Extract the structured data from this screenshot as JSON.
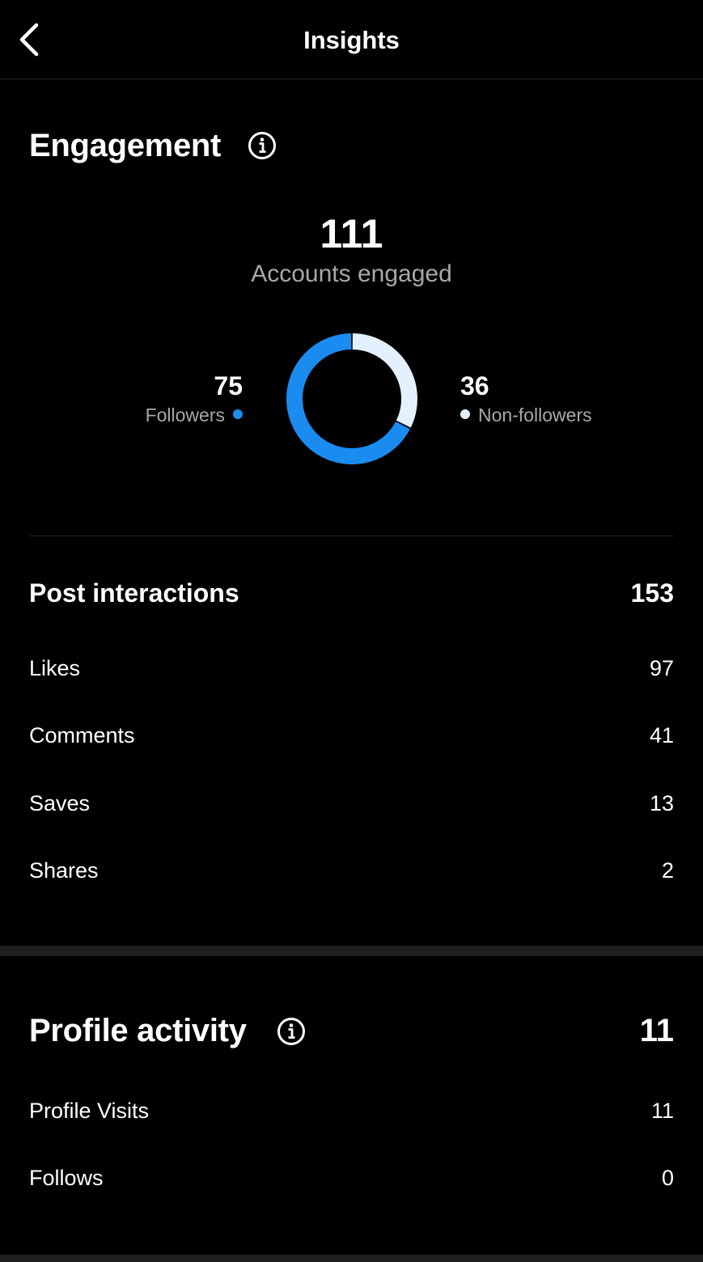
{
  "header": {
    "title": "Insights"
  },
  "engagement": {
    "title": "Engagement",
    "accounts_engaged": "111",
    "accounts_engaged_label": "Accounts engaged",
    "followers": {
      "value": "75",
      "label": "Followers",
      "color": "#1a8cf0"
    },
    "non_followers": {
      "value": "36",
      "label": "Non-followers",
      "color": "#e3f0fd"
    },
    "donut": {
      "followers": 75,
      "non_followers": 36
    }
  },
  "post_interactions": {
    "title": "Post interactions",
    "total": "153",
    "rows": [
      {
        "label": "Likes",
        "value": "97"
      },
      {
        "label": "Comments",
        "value": "41"
      },
      {
        "label": "Saves",
        "value": "13"
      },
      {
        "label": "Shares",
        "value": "2"
      }
    ]
  },
  "profile_activity": {
    "title": "Profile activity",
    "total": "11",
    "rows": [
      {
        "label": "Profile Visits",
        "value": "11"
      },
      {
        "label": "Follows",
        "value": "0"
      }
    ]
  },
  "icons": {
    "back": "chevron-left-icon",
    "info": "info-circle-icon"
  }
}
